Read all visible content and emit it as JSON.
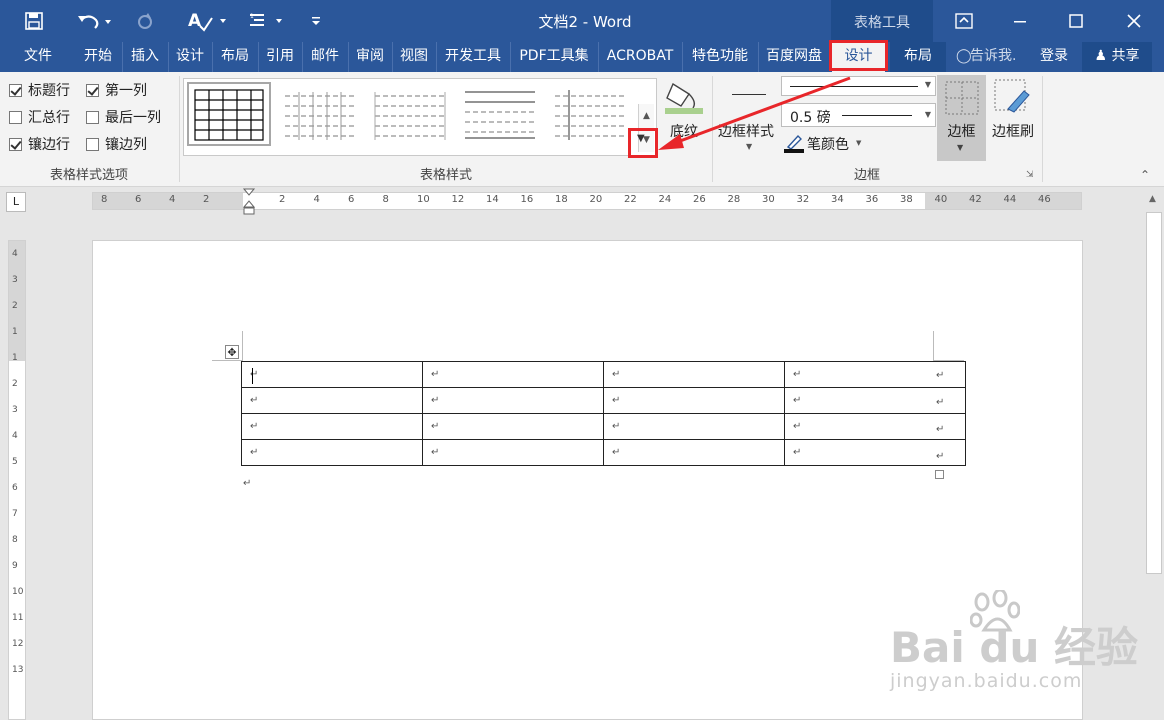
{
  "titlebar": {
    "doc_title": "文档2 - Word",
    "context_tab_title": "表格工具",
    "icons": [
      "save-icon",
      "undo-icon",
      "redo-icon",
      "spell-check-icon",
      "text-direction-icon",
      "customize-qat-icon",
      "ribbon-display-icon",
      "minimize-icon",
      "maximize-icon",
      "close-icon"
    ]
  },
  "tabs": {
    "file": "文件",
    "home": "开始",
    "insert": "插入",
    "design": "设计",
    "layout": "布局",
    "references": "引用",
    "mailings": "邮件",
    "review": "审阅",
    "view": "视图",
    "developer": "开发工具",
    "pdf": "PDF工具集",
    "acrobat": "ACROBAT",
    "special": "特色功能",
    "baidu": "百度网盘",
    "table_design": "设计",
    "table_layout": "布局",
    "tell_me": "告诉我.",
    "login": "登录",
    "share": "共享"
  },
  "style_options": {
    "header_row": {
      "label": "标题行",
      "checked": true
    },
    "first_column": {
      "label": "第一列",
      "checked": true
    },
    "total_row": {
      "label": "汇总行",
      "checked": false
    },
    "last_column": {
      "label": "最后一列",
      "checked": false
    },
    "banded_rows": {
      "label": "镶边行",
      "checked": true
    },
    "banded_columns": {
      "label": "镶边列",
      "checked": false
    },
    "group_label": "表格样式选项"
  },
  "table_styles": {
    "group_label": "表格样式",
    "shading_label": "底纹"
  },
  "borders": {
    "border_styles_label": "边框样式",
    "pen_weight": "0.5 磅",
    "pen_color_label": "笔颜色",
    "borders_label": "边框",
    "border_painter_label": "边框刷",
    "group_label": "边框"
  },
  "ruler": {
    "h_ticks": [
      "8",
      "6",
      "4",
      "2",
      "2",
      "4",
      "6",
      "8",
      "10",
      "12",
      "14",
      "16",
      "18",
      "20",
      "22",
      "24",
      "26",
      "28",
      "30",
      "32",
      "34",
      "36",
      "38",
      "40",
      "42",
      "44",
      "46"
    ],
    "v_ticks": [
      "4",
      "3",
      "2",
      "1",
      "1",
      "2",
      "3",
      "4",
      "5",
      "6",
      "7",
      "8",
      "9",
      "10",
      "11",
      "12",
      "13"
    ],
    "tab_selector": "L"
  },
  "document": {
    "table_rows": 4,
    "table_cols": 4,
    "paragraph_mark": "↵"
  },
  "watermark": {
    "logo_text": "Bai du 经验",
    "url": "jingyan.baidu.com"
  }
}
